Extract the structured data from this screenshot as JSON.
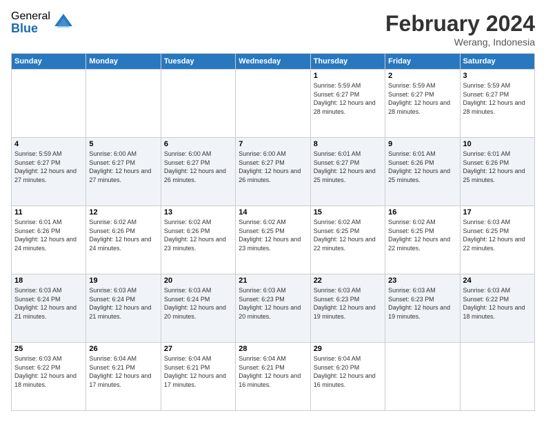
{
  "logo": {
    "general": "General",
    "blue": "Blue"
  },
  "header": {
    "month": "February 2024",
    "location": "Werang, Indonesia"
  },
  "days_of_week": [
    "Sunday",
    "Monday",
    "Tuesday",
    "Wednesday",
    "Thursday",
    "Friday",
    "Saturday"
  ],
  "weeks": [
    [
      {
        "day": "",
        "info": ""
      },
      {
        "day": "",
        "info": ""
      },
      {
        "day": "",
        "info": ""
      },
      {
        "day": "",
        "info": ""
      },
      {
        "day": "1",
        "info": "Sunrise: 5:59 AM\nSunset: 6:27 PM\nDaylight: 12 hours and 28 minutes."
      },
      {
        "day": "2",
        "info": "Sunrise: 5:59 AM\nSunset: 6:27 PM\nDaylight: 12 hours and 28 minutes."
      },
      {
        "day": "3",
        "info": "Sunrise: 5:59 AM\nSunset: 6:27 PM\nDaylight: 12 hours and 28 minutes."
      }
    ],
    [
      {
        "day": "4",
        "info": "Sunrise: 5:59 AM\nSunset: 6:27 PM\nDaylight: 12 hours and 27 minutes."
      },
      {
        "day": "5",
        "info": "Sunrise: 6:00 AM\nSunset: 6:27 PM\nDaylight: 12 hours and 27 minutes."
      },
      {
        "day": "6",
        "info": "Sunrise: 6:00 AM\nSunset: 6:27 PM\nDaylight: 12 hours and 26 minutes."
      },
      {
        "day": "7",
        "info": "Sunrise: 6:00 AM\nSunset: 6:27 PM\nDaylight: 12 hours and 26 minutes."
      },
      {
        "day": "8",
        "info": "Sunrise: 6:01 AM\nSunset: 6:27 PM\nDaylight: 12 hours and 25 minutes."
      },
      {
        "day": "9",
        "info": "Sunrise: 6:01 AM\nSunset: 6:26 PM\nDaylight: 12 hours and 25 minutes."
      },
      {
        "day": "10",
        "info": "Sunrise: 6:01 AM\nSunset: 6:26 PM\nDaylight: 12 hours and 25 minutes."
      }
    ],
    [
      {
        "day": "11",
        "info": "Sunrise: 6:01 AM\nSunset: 6:26 PM\nDaylight: 12 hours and 24 minutes."
      },
      {
        "day": "12",
        "info": "Sunrise: 6:02 AM\nSunset: 6:26 PM\nDaylight: 12 hours and 24 minutes."
      },
      {
        "day": "13",
        "info": "Sunrise: 6:02 AM\nSunset: 6:26 PM\nDaylight: 12 hours and 23 minutes."
      },
      {
        "day": "14",
        "info": "Sunrise: 6:02 AM\nSunset: 6:25 PM\nDaylight: 12 hours and 23 minutes."
      },
      {
        "day": "15",
        "info": "Sunrise: 6:02 AM\nSunset: 6:25 PM\nDaylight: 12 hours and 22 minutes."
      },
      {
        "day": "16",
        "info": "Sunrise: 6:02 AM\nSunset: 6:25 PM\nDaylight: 12 hours and 22 minutes."
      },
      {
        "day": "17",
        "info": "Sunrise: 6:03 AM\nSunset: 6:25 PM\nDaylight: 12 hours and 22 minutes."
      }
    ],
    [
      {
        "day": "18",
        "info": "Sunrise: 6:03 AM\nSunset: 6:24 PM\nDaylight: 12 hours and 21 minutes."
      },
      {
        "day": "19",
        "info": "Sunrise: 6:03 AM\nSunset: 6:24 PM\nDaylight: 12 hours and 21 minutes."
      },
      {
        "day": "20",
        "info": "Sunrise: 6:03 AM\nSunset: 6:24 PM\nDaylight: 12 hours and 20 minutes."
      },
      {
        "day": "21",
        "info": "Sunrise: 6:03 AM\nSunset: 6:23 PM\nDaylight: 12 hours and 20 minutes."
      },
      {
        "day": "22",
        "info": "Sunrise: 6:03 AM\nSunset: 6:23 PM\nDaylight: 12 hours and 19 minutes."
      },
      {
        "day": "23",
        "info": "Sunrise: 6:03 AM\nSunset: 6:23 PM\nDaylight: 12 hours and 19 minutes."
      },
      {
        "day": "24",
        "info": "Sunrise: 6:03 AM\nSunset: 6:22 PM\nDaylight: 12 hours and 18 minutes."
      }
    ],
    [
      {
        "day": "25",
        "info": "Sunrise: 6:03 AM\nSunset: 6:22 PM\nDaylight: 12 hours and 18 minutes."
      },
      {
        "day": "26",
        "info": "Sunrise: 6:04 AM\nSunset: 6:21 PM\nDaylight: 12 hours and 17 minutes."
      },
      {
        "day": "27",
        "info": "Sunrise: 6:04 AM\nSunset: 6:21 PM\nDaylight: 12 hours and 17 minutes."
      },
      {
        "day": "28",
        "info": "Sunrise: 6:04 AM\nSunset: 6:21 PM\nDaylight: 12 hours and 16 minutes."
      },
      {
        "day": "29",
        "info": "Sunrise: 6:04 AM\nSunset: 6:20 PM\nDaylight: 12 hours and 16 minutes."
      },
      {
        "day": "",
        "info": ""
      },
      {
        "day": "",
        "info": ""
      }
    ]
  ]
}
